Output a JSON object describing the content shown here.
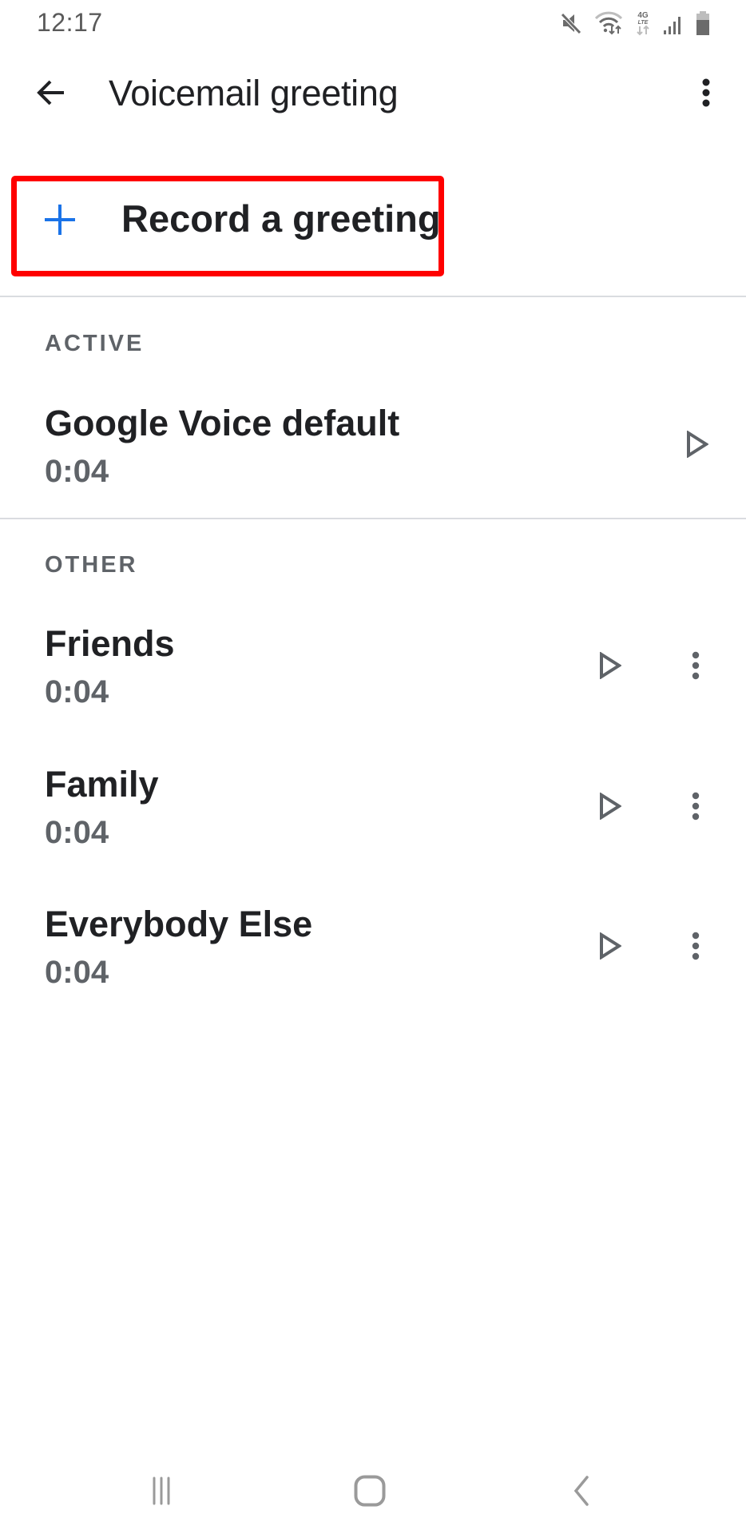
{
  "status_bar": {
    "time": "12:17",
    "icons": [
      "mute-icon",
      "wifi-icon",
      "lte-4g-icon",
      "signal-icon",
      "battery-icon"
    ],
    "lte_label_top": "4G",
    "lte_label_bottom": "LTE"
  },
  "app_bar": {
    "title": "Voicemail greeting",
    "back_icon": "arrow-back-icon",
    "overflow_icon": "more-vert-icon"
  },
  "record": {
    "label": "Record a greeting",
    "icon": "plus-icon",
    "accent_color": "#1a73e8",
    "highlight_color": "#ff0000"
  },
  "sections": {
    "active": {
      "header": "ACTIVE",
      "items": [
        {
          "title": "Google Voice default",
          "duration": "0:04",
          "has_menu": false
        }
      ]
    },
    "other": {
      "header": "OTHER",
      "items": [
        {
          "title": "Friends",
          "duration": "0:04",
          "has_menu": true
        },
        {
          "title": "Family",
          "duration": "0:04",
          "has_menu": true
        },
        {
          "title": "Everybody Else",
          "duration": "0:04",
          "has_menu": true
        }
      ]
    }
  },
  "nav_bar": {
    "buttons": [
      "recents-icon",
      "home-icon",
      "back-icon"
    ]
  },
  "colors": {
    "text_primary": "#202124",
    "text_secondary": "#5f6368",
    "divider": "#dadce0"
  }
}
